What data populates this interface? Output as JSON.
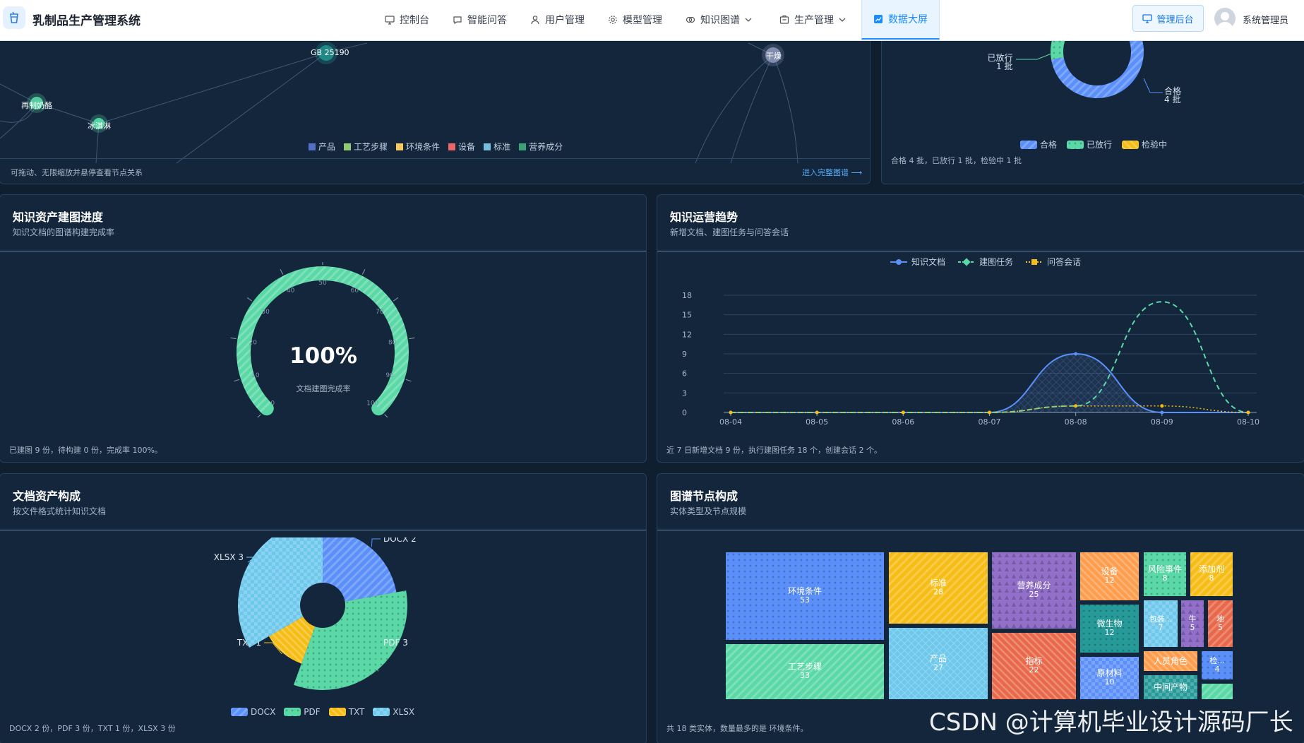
{
  "app": {
    "title": "乳制品生产管理系统"
  },
  "nav": [
    {
      "label": "控制台",
      "icon": "monitor-icon"
    },
    {
      "label": "智能问答",
      "icon": "chat-icon"
    },
    {
      "label": "用户管理",
      "icon": "user-icon"
    },
    {
      "label": "模型管理",
      "icon": "gear-icon"
    },
    {
      "label": "知识图谱",
      "icon": "graph-icon"
    },
    {
      "label": "生产管理",
      "icon": "factory-icon"
    },
    {
      "label": "数据大屏",
      "icon": "dashboard-icon"
    }
  ],
  "header": {
    "admin_button": "管理后台",
    "user_name": "系统管理员"
  },
  "graph_panel": {
    "nodes": [
      "GB 25190",
      "再制奶酪",
      "冰淇淋",
      "干燥"
    ],
    "legend": [
      {
        "label": "产品",
        "color": "#5470c6"
      },
      {
        "label": "工艺步骤",
        "color": "#91cc75"
      },
      {
        "label": "环境条件",
        "color": "#fac858"
      },
      {
        "label": "设备",
        "color": "#ee6666"
      },
      {
        "label": "标准",
        "color": "#73c0de"
      },
      {
        "label": "营养成分",
        "color": "#3ba272"
      }
    ],
    "footer": "可拖动、无限缩放并悬停查看节点关系",
    "link": "进入完整图谱 ⟶"
  },
  "batch_panel": {
    "labels": {
      "released": "已放行",
      "released_count": "1 批",
      "passed": "合格",
      "passed_count": "4 批"
    },
    "legend": [
      "合格",
      "已放行",
      "检验中"
    ],
    "footer": "合格 4 批，已放行 1 批，检验中 1 批"
  },
  "progress_panel": {
    "title": "知识资产建图进度",
    "subtitle": "知识文档的图谱构建完成率",
    "value": "100%",
    "value_label": "文档建图完成率",
    "footer": "已建图 9 份，待构建 0 份，完成率 100%。"
  },
  "trend_panel": {
    "title": "知识运营趋势",
    "subtitle": "新增文档、建图任务与问答会话",
    "footer": "近 7 日新增文档 9 份，执行建图任务 18 个，创建会话 2 个。"
  },
  "doc_panel": {
    "title": "文档资产构成",
    "subtitle": "按文件格式统计知识文档",
    "footer": "DOCX 2 份，PDF 3 份，TXT 1 份，XLSX 3 份"
  },
  "node_panel": {
    "title": "图谱节点构成",
    "subtitle": "实体类型及节点规模",
    "footer": "共 18 类实体，数量最多的是 环境条件。"
  },
  "chart_data": [
    {
      "type": "pie",
      "name": "batch_status",
      "categories": [
        "合格",
        "已放行",
        "检验中"
      ],
      "values": [
        4,
        1,
        1
      ],
      "colors": [
        "#5b8ff9",
        "#5ad8a6",
        "#f6bd16"
      ]
    },
    {
      "type": "gauge",
      "name": "build_progress",
      "value": 100,
      "range": [
        0,
        100
      ],
      "ticks": [
        "0",
        "10",
        "20",
        "30",
        "40",
        "50",
        "60",
        "70",
        "80",
        "90",
        "100"
      ],
      "color": "#5ad8a6"
    },
    {
      "type": "line",
      "name": "trend",
      "categories": [
        "08-04",
        "08-05",
        "08-06",
        "08-07",
        "08-08",
        "08-09",
        "08-10"
      ],
      "ylim": [
        0,
        18
      ],
      "yticks": [
        0,
        3,
        6,
        9,
        12,
        15,
        18
      ],
      "series": [
        {
          "name": "知识文档",
          "values": [
            0,
            0,
            0,
            0,
            9,
            0,
            0
          ],
          "color": "#5b8ff9"
        },
        {
          "name": "建图任务",
          "values": [
            0,
            0,
            0,
            0,
            1,
            17,
            0
          ],
          "color": "#5ad8a6"
        },
        {
          "name": "问答会话",
          "values": [
            0,
            0,
            0,
            0,
            1,
            1,
            0
          ],
          "color": "#f6bd16"
        }
      ]
    },
    {
      "type": "pie",
      "name": "doc_formats",
      "categories": [
        "DOCX",
        "PDF",
        "TXT",
        "XLSX"
      ],
      "values": [
        2,
        3,
        1,
        3
      ],
      "colors": [
        "#5b8ff9",
        "#5ad8a6",
        "#f6bd16",
        "#6dc8ec"
      ],
      "labels": [
        "DOCX 2",
        "PDF 3",
        "TXT 1",
        "XLSX 3"
      ]
    },
    {
      "type": "treemap",
      "name": "node_types",
      "items": [
        {
          "name": "环境条件",
          "value": 53,
          "color": "#5b8ff9"
        },
        {
          "name": "工艺步骤",
          "value": 33,
          "color": "#5ad8a6"
        },
        {
          "name": "标准",
          "value": 28,
          "color": "#f6bd16"
        },
        {
          "name": "产品",
          "value": 27,
          "color": "#6dc8ec"
        },
        {
          "name": "营养成分",
          "value": 25,
          "color": "#9270ca"
        },
        {
          "name": "指标",
          "value": 22,
          "color": "#e8684a"
        },
        {
          "name": "设备",
          "value": 12,
          "color": "#ff9d4d"
        },
        {
          "name": "微生物",
          "value": 12,
          "color": "#269a99"
        },
        {
          "name": "原材料",
          "value": 10,
          "color": "#5b8ff9"
        },
        {
          "name": "风险事件",
          "value": 8,
          "color": "#5ad8a6"
        },
        {
          "name": "添加剂",
          "value": 8,
          "color": "#f6bd16"
        },
        {
          "name": "包装...",
          "value": 7,
          "color": "#6dc8ec"
        },
        {
          "name": "牛",
          "value": 5,
          "color": "#9270ca"
        },
        {
          "name": "地",
          "value": 5,
          "color": "#e8684a"
        },
        {
          "name": "人员角色",
          "value": "",
          "color": "#ff9d4d"
        },
        {
          "name": "检...",
          "value": 4,
          "color": "#5b8ff9"
        },
        {
          "name": "中间产物",
          "value": "",
          "color": "#269a99"
        },
        {
          "name": "",
          "value": "",
          "color": "#5ad8a6"
        }
      ]
    }
  ],
  "watermark": "CSDN @计算机毕业设计源码厂长"
}
